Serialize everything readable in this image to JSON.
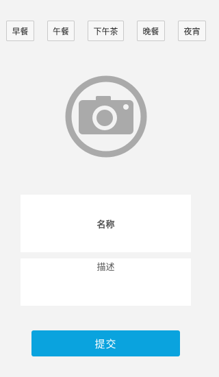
{
  "meals": [
    {
      "label": "早餐"
    },
    {
      "label": "午餐"
    },
    {
      "label": "下午茶"
    },
    {
      "label": "晚餐"
    },
    {
      "label": "夜宵"
    }
  ],
  "photo": {
    "icon": "camera-icon",
    "color": "#aaaaaa"
  },
  "form": {
    "name_label": "名称",
    "desc_label": "描述"
  },
  "submit": {
    "label": "提交",
    "color": "#0aa3de"
  }
}
